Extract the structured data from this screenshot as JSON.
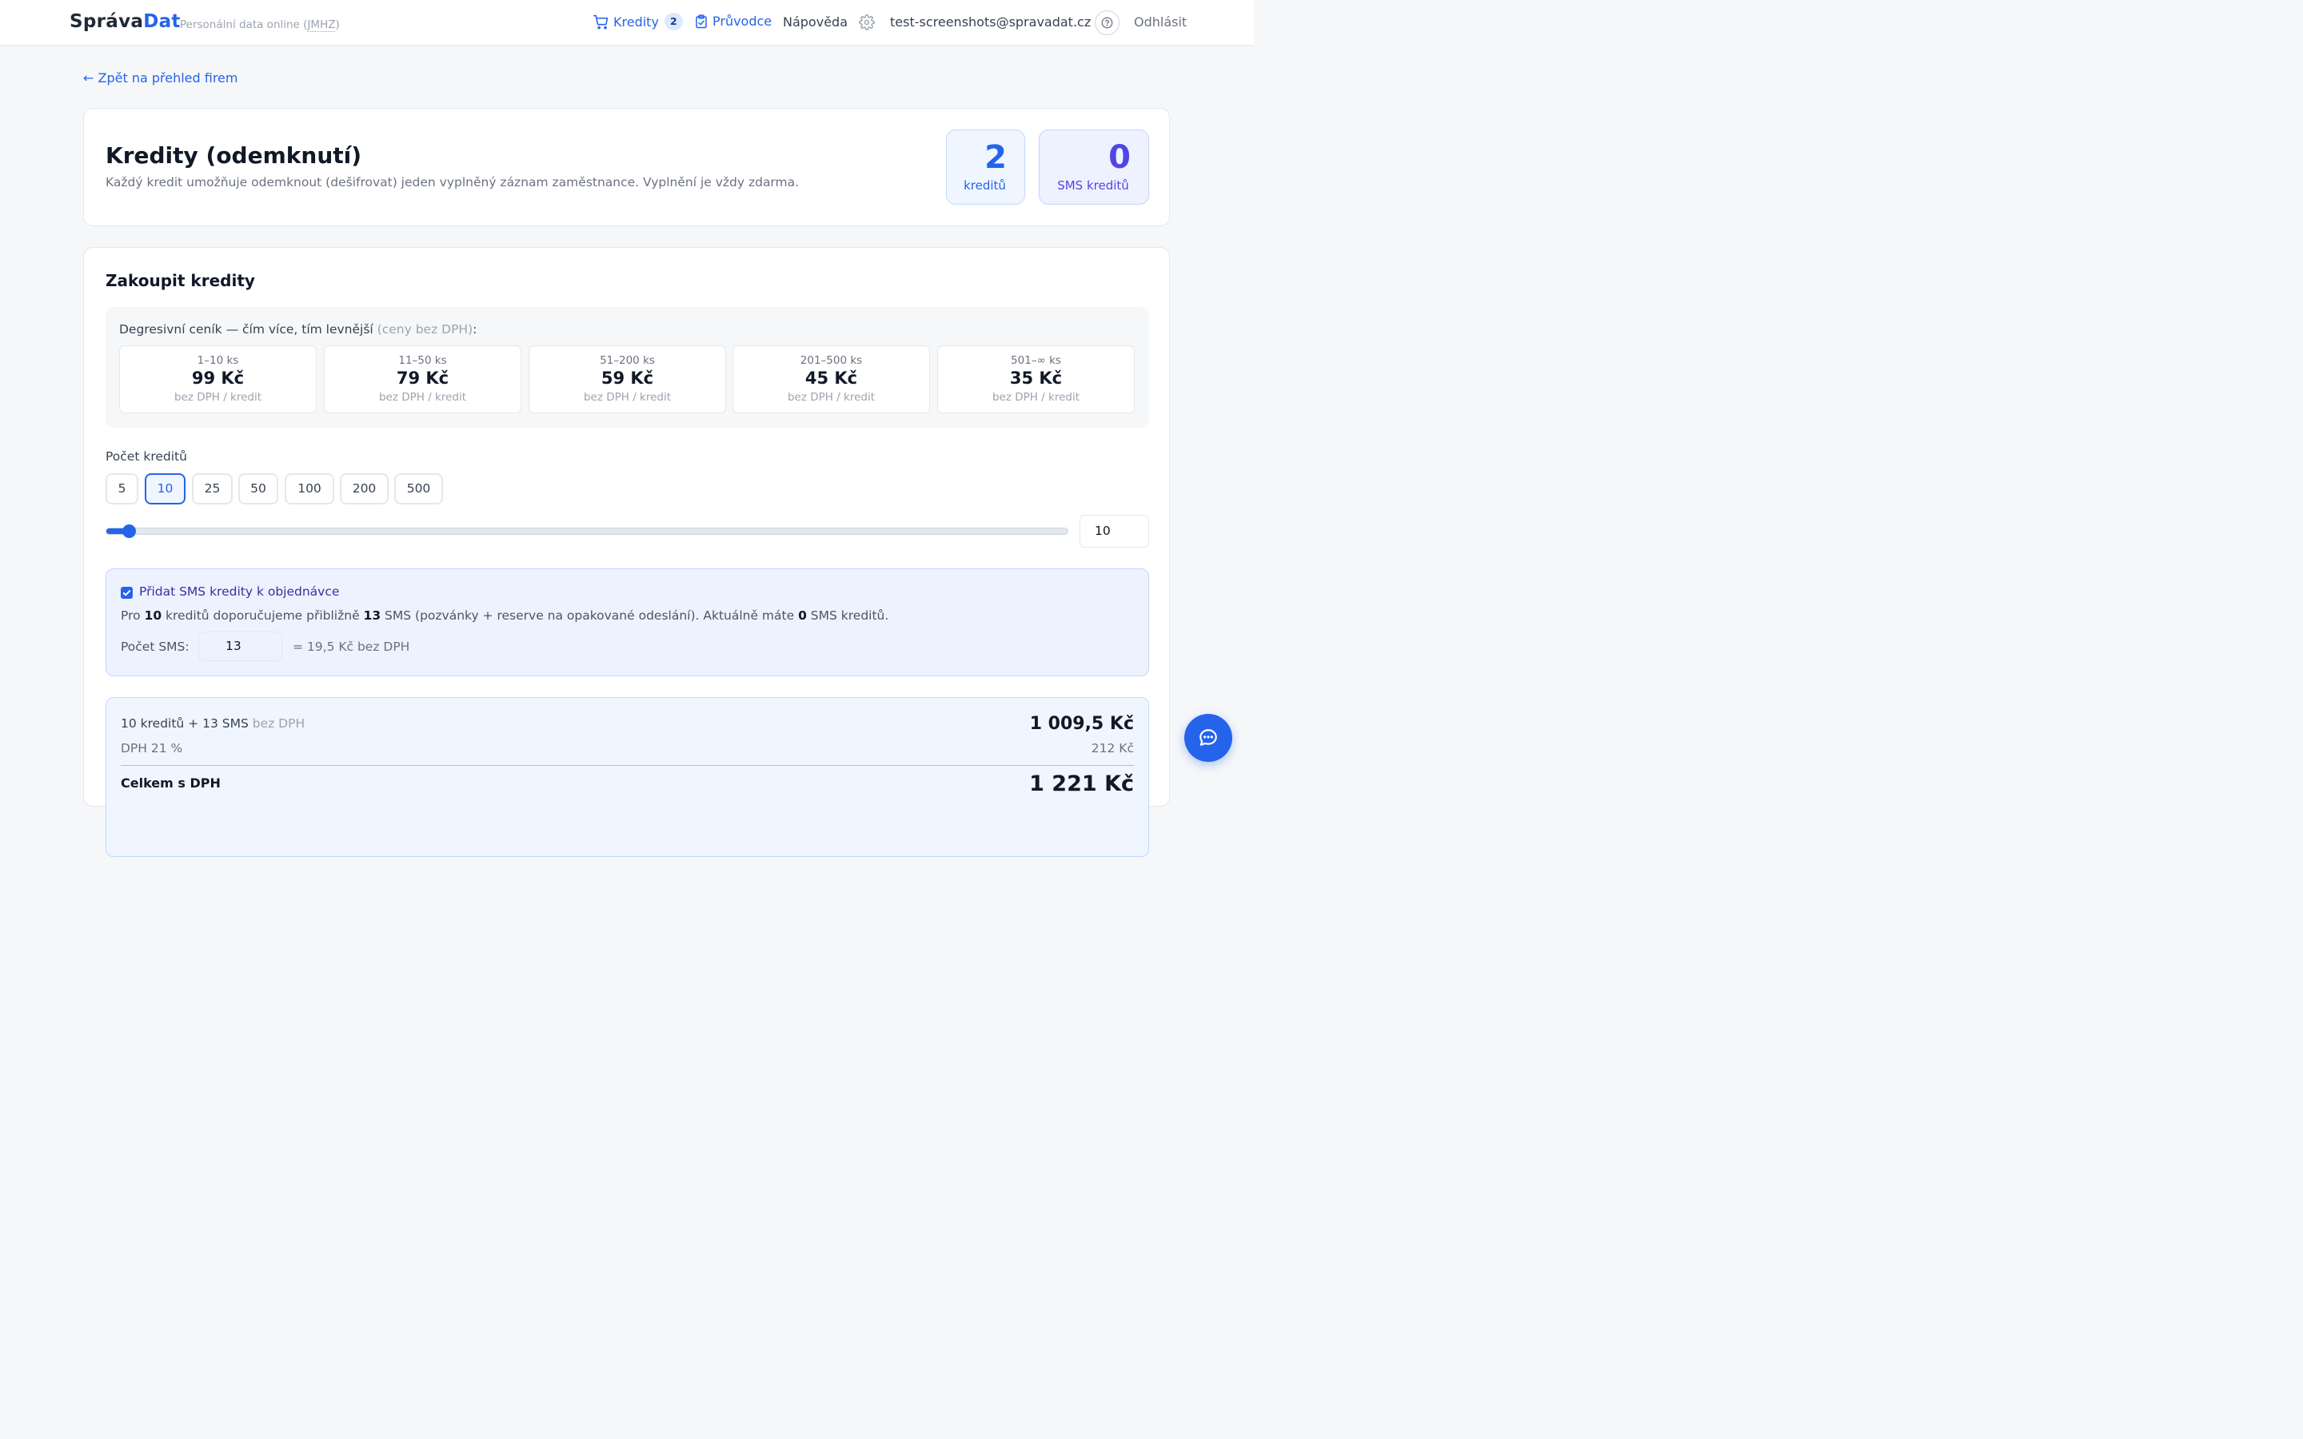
{
  "header": {
    "brand_part1": "Správa",
    "brand_part2": "Dat",
    "tagline_prefix": "Personální data online (",
    "tagline_abbr": "JMHZ",
    "tagline_suffix": ")",
    "credits_label": "Kredity",
    "credits_badge": "2",
    "guide_label": "Průvodce",
    "help_label": "Nápověda",
    "user_email": "test-screenshots@spravadat.cz",
    "logout_label": "Odhlásit"
  },
  "back_link": "← Zpět na přehled firem",
  "credits_card": {
    "title": "Kredity (odemknutí)",
    "subtitle": "Každý kredit umožňuje odemknout (dešifrovat) jeden vyplněný záznam zaměstnance. Vyplnění je vždy zdarma.",
    "credits_value": "2",
    "credits_label": "kreditů",
    "sms_value": "0",
    "sms_label": "SMS kreditů"
  },
  "purchase": {
    "title": "Zakoupit kredity",
    "pricing_intro": "Degresivní ceník — čím více, tím levnější",
    "pricing_note": "(ceny bez DPH)",
    "pricing_colon": ":",
    "tiers": [
      {
        "range": "1–10 ks",
        "price": "99 Kč",
        "unit": "bez DPH / kredit"
      },
      {
        "range": "11–50 ks",
        "price": "79 Kč",
        "unit": "bez DPH / kredit"
      },
      {
        "range": "51–200 ks",
        "price": "59 Kč",
        "unit": "bez DPH / kredit"
      },
      {
        "range": "201–500 ks",
        "price": "45 Kč",
        "unit": "bez DPH / kredit"
      },
      {
        "range": "501–∞ ks",
        "price": "35 Kč",
        "unit": "bez DPH / kredit"
      }
    ],
    "count_label": "Počet kreditů",
    "quantity_options": [
      "5",
      "10",
      "25",
      "50",
      "100",
      "200",
      "500"
    ],
    "selected_quantity": "10",
    "slider_value": "10",
    "slider_min": 1,
    "slider_max": 500,
    "sms": {
      "checkbox_label": "Přidat SMS kredity k objednávce",
      "checked": true,
      "text_prefix": "Pro ",
      "text_credits": "10",
      "text_mid": " kreditů doporučujeme přibližně ",
      "text_sms": "13",
      "text_mid2": " SMS (pozvánky + reserve na opakované odeslání). Aktuálně máte ",
      "text_current": "0",
      "text_suffix": " SMS kreditů.",
      "count_label": "Počet SMS:",
      "count_value": "13",
      "price_text": "= 19,5 Kč bez DPH"
    },
    "summary": {
      "line1": "10 kreditů + 13 SMS",
      "line1_note": "bez DPH",
      "value1": "1 009,5 Kč",
      "line2": "DPH 21 %",
      "value2": "212 Kč",
      "line3": "Celkem s DPH",
      "value3": "1 221 Kč"
    }
  },
  "colors": {
    "accent": "#2563eb",
    "indigo": "#4f46e5"
  }
}
